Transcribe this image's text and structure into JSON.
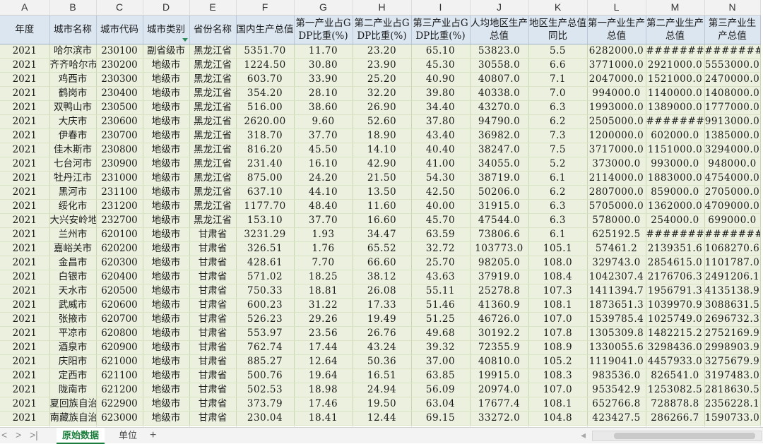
{
  "sheet": {
    "columns": [
      "A",
      "B",
      "C",
      "D",
      "E",
      "F",
      "G",
      "H",
      "I",
      "J",
      "K",
      "L",
      "M",
      "N"
    ],
    "headers": [
      "年度",
      "城市名称",
      "城市代码",
      "城市类别",
      "省份名称",
      "国内生产总值",
      "第一产业占GDP比重(%)",
      "第二产业占GDP比重(%)",
      "第三产业占GDP比重(%)",
      "人均地区生产总值",
      "地区生产总值同比",
      "第一产业生产总值",
      "第二产业生产总值",
      "第三产业生产总值"
    ],
    "rows": [
      [
        "2021",
        "哈尔滨市",
        "230100",
        "副省级市",
        "黑龙江省",
        "5351.70",
        "11.70",
        "23.20",
        "65.10",
        "53823.0",
        "5.5",
        "6282000.0",
        "##########",
        "##########"
      ],
      [
        "2021",
        "齐齐哈尔市",
        "230200",
        "地级市",
        "黑龙江省",
        "1224.50",
        "30.80",
        "23.90",
        "45.30",
        "30558.0",
        "6.6",
        "3771000.0",
        "2921000.0",
        "5553000.0"
      ],
      [
        "2021",
        "鸡西市",
        "230300",
        "地级市",
        "黑龙江省",
        "603.70",
        "33.90",
        "25.20",
        "40.90",
        "40807.0",
        "7.1",
        "2047000.0",
        "1521000.0",
        "2470000.0"
      ],
      [
        "2021",
        "鹤岗市",
        "230400",
        "地级市",
        "黑龙江省",
        "354.20",
        "28.10",
        "32.20",
        "39.80",
        "40338.0",
        "7.0",
        "994000.0",
        "1140000.0",
        "1408000.0"
      ],
      [
        "2021",
        "双鸭山市",
        "230500",
        "地级市",
        "黑龙江省",
        "516.00",
        "38.60",
        "26.90",
        "34.40",
        "43270.0",
        "6.3",
        "1993000.0",
        "1389000.0",
        "1777000.0"
      ],
      [
        "2021",
        "大庆市",
        "230600",
        "地级市",
        "黑龙江省",
        "2620.00",
        "9.60",
        "52.60",
        "37.80",
        "94790.0",
        "6.2",
        "2505000.0",
        "##########",
        "9913000.0"
      ],
      [
        "2021",
        "伊春市",
        "230700",
        "地级市",
        "黑龙江省",
        "318.70",
        "37.70",
        "18.90",
        "43.40",
        "36982.0",
        "7.3",
        "1200000.0",
        "602000.0",
        "1385000.0"
      ],
      [
        "2021",
        "佳木斯市",
        "230800",
        "地级市",
        "黑龙江省",
        "816.20",
        "45.50",
        "14.10",
        "40.40",
        "38247.0",
        "7.5",
        "3717000.0",
        "1151000.0",
        "3294000.0"
      ],
      [
        "2021",
        "七台河市",
        "230900",
        "地级市",
        "黑龙江省",
        "231.40",
        "16.10",
        "42.90",
        "41.00",
        "34055.0",
        "5.2",
        "373000.0",
        "993000.0",
        "948000.0"
      ],
      [
        "2021",
        "牡丹江市",
        "231000",
        "地级市",
        "黑龙江省",
        "875.00",
        "24.20",
        "21.50",
        "54.30",
        "38719.0",
        "6.1",
        "2114000.0",
        "1883000.0",
        "4754000.0"
      ],
      [
        "2021",
        "黑河市",
        "231100",
        "地级市",
        "黑龙江省",
        "637.10",
        "44.10",
        "13.50",
        "42.50",
        "50206.0",
        "6.2",
        "2807000.0",
        "859000.0",
        "2705000.0"
      ],
      [
        "2021",
        "绥化市",
        "231200",
        "地级市",
        "黑龙江省",
        "1177.70",
        "48.40",
        "11.60",
        "40.00",
        "31915.0",
        "6.3",
        "5705000.0",
        "1362000.0",
        "4709000.0"
      ],
      [
        "2021",
        "大兴安岭地区",
        "232700",
        "地级市",
        "黑龙江省",
        "153.10",
        "37.70",
        "16.60",
        "45.70",
        "47544.0",
        "6.3",
        "578000.0",
        "254000.0",
        "699000.0"
      ],
      [
        "2021",
        "兰州市",
        "620100",
        "地级市",
        "甘肃省",
        "3231.29",
        "1.93",
        "34.47",
        "63.59",
        "73806.6",
        "6.1",
        "625192.5",
        "##########",
        "##########"
      ],
      [
        "2021",
        "嘉峪关市",
        "620200",
        "地级市",
        "甘肃省",
        "326.51",
        "1.76",
        "65.52",
        "32.72",
        "103773.0",
        "105.1",
        "57461.2",
        "2139351.6",
        "1068270.6"
      ],
      [
        "2021",
        "金昌市",
        "620300",
        "地级市",
        "甘肃省",
        "428.61",
        "7.70",
        "66.60",
        "25.70",
        "98205.0",
        "108.0",
        "329743.0",
        "2854615.0",
        "1101787.0"
      ],
      [
        "2021",
        "白银市",
        "620400",
        "地级市",
        "甘肃省",
        "571.02",
        "18.25",
        "38.12",
        "43.63",
        "37919.0",
        "108.4",
        "1042307.4",
        "2176706.3",
        "2491206.1"
      ],
      [
        "2021",
        "天水市",
        "620500",
        "地级市",
        "甘肃省",
        "750.33",
        "18.81",
        "26.08",
        "55.11",
        "25278.8",
        "107.3",
        "1411394.7",
        "1956791.3",
        "4135138.9"
      ],
      [
        "2021",
        "武威市",
        "620600",
        "地级市",
        "甘肃省",
        "600.23",
        "31.22",
        "17.33",
        "51.46",
        "41360.9",
        "108.1",
        "1873651.3",
        "1039970.9",
        "3088631.5"
      ],
      [
        "2021",
        "张掖市",
        "620700",
        "地级市",
        "甘肃省",
        "526.23",
        "29.26",
        "19.49",
        "51.25",
        "46726.0",
        "107.0",
        "1539785.4",
        "1025749.0",
        "2696732.3"
      ],
      [
        "2021",
        "平凉市",
        "620800",
        "地级市",
        "甘肃省",
        "553.97",
        "23.56",
        "26.76",
        "49.68",
        "30192.2",
        "107.8",
        "1305309.8",
        "1482215.2",
        "2752169.9"
      ],
      [
        "2021",
        "酒泉市",
        "620900",
        "地级市",
        "甘肃省",
        "762.74",
        "17.44",
        "43.24",
        "39.32",
        "72355.9",
        "108.9",
        "1330055.6",
        "3298436.0",
        "2998903.9"
      ],
      [
        "2021",
        "庆阳市",
        "621000",
        "地级市",
        "甘肃省",
        "885.27",
        "12.64",
        "50.36",
        "37.00",
        "40810.0",
        "105.2",
        "1119041.0",
        "4457933.0",
        "3275679.9"
      ],
      [
        "2021",
        "定西市",
        "621100",
        "地级市",
        "甘肃省",
        "500.76",
        "19.64",
        "16.51",
        "63.85",
        "19915.0",
        "108.3",
        "983536.0",
        "826541.0",
        "3197483.0"
      ],
      [
        "2021",
        "陇南市",
        "621200",
        "地级市",
        "甘肃省",
        "502.53",
        "18.98",
        "24.94",
        "56.09",
        "20974.0",
        "107.0",
        "953542.9",
        "1253082.5",
        "2818630.5"
      ],
      [
        "2021",
        "夏回族自治",
        "622900",
        "地级市",
        "甘肃省",
        "373.79",
        "17.46",
        "19.50",
        "63.04",
        "17677.4",
        "108.1",
        "652766.8",
        "728878.8",
        "2356228.1"
      ],
      [
        "2021",
        "南藏族自治",
        "623000",
        "地级市",
        "甘肃省",
        "230.04",
        "18.41",
        "12.44",
        "69.15",
        "33272.0",
        "104.8",
        "423427.5",
        "286266.7",
        "1590733.0"
      ]
    ],
    "blank_rows": 2
  },
  "tabs": {
    "items": [
      "原始数据",
      "单位"
    ],
    "active": 0,
    "add": "+"
  },
  "nav": {
    "first": "<",
    "prev": ">",
    "last": ">|",
    "scroll_left": "◂"
  }
}
